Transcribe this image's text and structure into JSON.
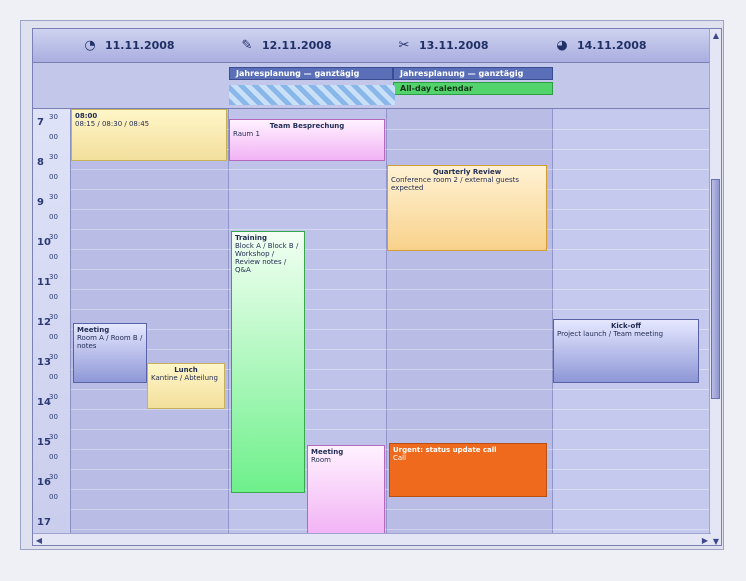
{
  "days": [
    {
      "icon": "day-icon-1",
      "label": "11.11.2008"
    },
    {
      "icon": "day-icon-2",
      "label": "12.11.2008"
    },
    {
      "icon": "day-icon-3",
      "label": "13.11.2008"
    },
    {
      "icon": "day-icon-4",
      "label": "14.11.2008"
    }
  ],
  "allday": {
    "banner1": "Jahresplanung — ganztägig",
    "banner2": "Jahresplanung — ganztägig",
    "banner3": "All-day calendar"
  },
  "times": [
    "7",
    "8",
    "9",
    "10",
    "11",
    "12",
    "13",
    "14",
    "15",
    "16",
    "17"
  ],
  "minutes": [
    "30",
    "00",
    "30",
    "00",
    "30",
    "00",
    "30",
    "00",
    "30",
    "00",
    "30",
    "00",
    "30",
    "00",
    "30",
    "00",
    "30",
    "00",
    "30",
    "00"
  ],
  "events": {
    "yellow_stack": {
      "title": "08:00",
      "text": "08:15 / 08:30 / 08:45"
    },
    "pink_top": {
      "title": "Team Besprechung",
      "text": "Raum 1"
    },
    "orange_top": {
      "title": "Quarterly Review",
      "text": "Conference room 2 / external guests expected"
    },
    "green_long": {
      "title": "Training",
      "text": "Block A / Block B / Workshop / Review notes / Q&A"
    },
    "blue_left": {
      "title": "Meeting",
      "text": "Room A / Room B / notes"
    },
    "yellow_small": {
      "title": "Lunch",
      "text": "Kantine / Abteilung"
    },
    "pink_bottom": {
      "title": "Meeting",
      "text": "Room"
    },
    "orange_bottom": {
      "title": "Urgent: status update call",
      "text": "Call"
    },
    "blue_right": {
      "title": "Kick-off",
      "text": "Project launch / Team meeting"
    }
  },
  "colors": {
    "accent": "#5a6fb8",
    "green": "#53d36b",
    "orange": "#f06a1e",
    "yellow": "#f2df9c",
    "pink": "#f2b3f5"
  }
}
